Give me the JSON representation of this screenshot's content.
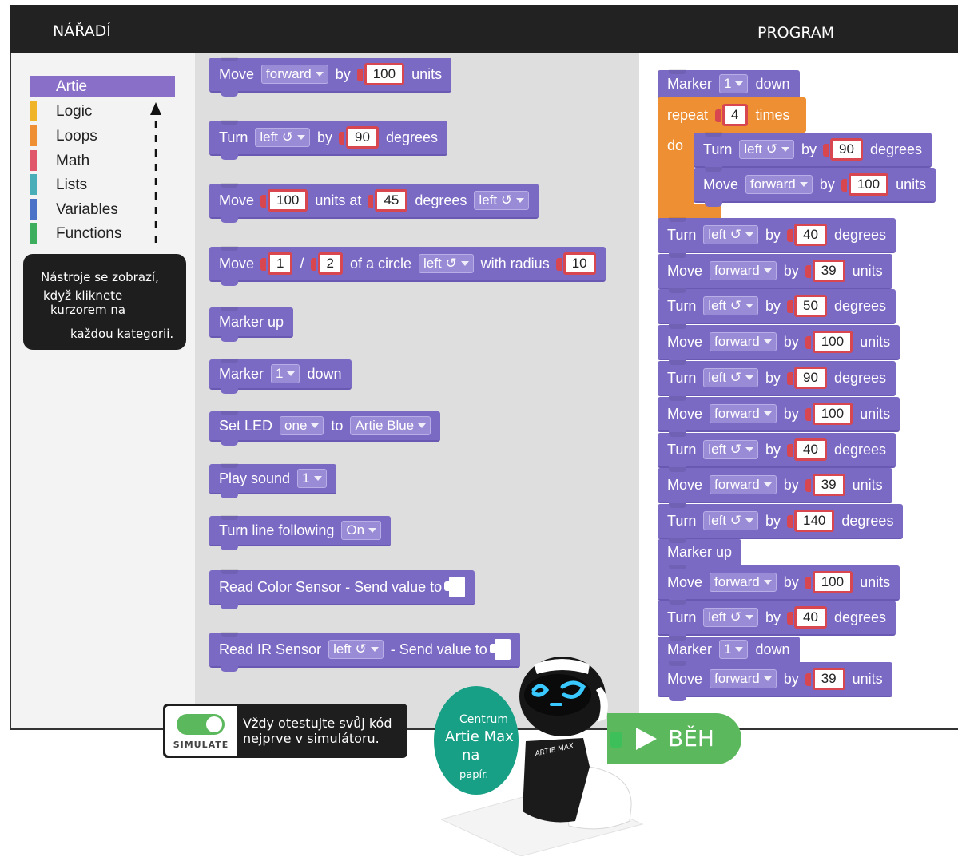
{
  "header": {
    "tools_title": "NÁŘADÍ",
    "program_title": "PROGRAM"
  },
  "categories": [
    {
      "label": "Artie",
      "color": "#8a6fc9",
      "selected": true
    },
    {
      "label": "Logic",
      "color": "#f0b429"
    },
    {
      "label": "Loops",
      "color": "#ed8f32"
    },
    {
      "label": "Math",
      "color": "#e0566b"
    },
    {
      "label": "Lists",
      "color": "#4aaeb8"
    },
    {
      "label": "Variables",
      "color": "#4a73c8"
    },
    {
      "label": "Functions",
      "color": "#3dae5e"
    }
  ],
  "tooltip": {
    "line1": "Nástroje se zobrazí,",
    "line2": "když kliknete",
    "line3": "kurzorem na",
    "line4": "každou kategorii."
  },
  "palette": {
    "move": {
      "w1": "Move",
      "dd": "forward",
      "w2": "by",
      "num": "100",
      "w3": "units"
    },
    "turn": {
      "w1": "Turn",
      "dd": "left ↺",
      "w2": "by",
      "num": "90",
      "w3": "degrees"
    },
    "move_arc": {
      "w1": "Move",
      "num1": "100",
      "w2": "units at",
      "num2": "45",
      "w3": "degrees",
      "dd": "left ↺"
    },
    "move_circle": {
      "w1": "Move",
      "num1": "1",
      "slash": "/",
      "num2": "2",
      "w2": "of a circle",
      "dd": "left ↺",
      "w3": "with radius",
      "num3": "10"
    },
    "marker_up": "Marker up",
    "marker_down": {
      "w1": "Marker",
      "dd": "1",
      "w2": "down"
    },
    "set_led": {
      "w1": "Set LED",
      "dd1": "one",
      "w2": "to",
      "dd2": "Artie Blue"
    },
    "play_sound": {
      "w1": "Play sound",
      "dd": "1"
    },
    "line_following": {
      "w1": "Turn line following",
      "dd": "On"
    },
    "color_sensor": "Read Color Sensor - Send value to",
    "ir_sensor": {
      "w1": "Read IR Sensor",
      "dd": "left ↺",
      "w2": "- Send value to"
    }
  },
  "program": {
    "marker_down_1": {
      "w1": "Marker",
      "dd": "1",
      "w2": "down"
    },
    "repeat": {
      "w1": "repeat",
      "num": "4",
      "w2": "times",
      "do": "do"
    },
    "inner_turn": {
      "w1": "Turn",
      "dd": "left ↺",
      "w2": "by",
      "num": "90",
      "w3": "degrees"
    },
    "inner_move": {
      "w1": "Move",
      "dd": "forward",
      "w2": "by",
      "num": "100",
      "w3": "units"
    },
    "steps": [
      {
        "w1": "Turn",
        "dd": "left ↺",
        "w2": "by",
        "num": "40",
        "w3": "degrees"
      },
      {
        "w1": "Move",
        "dd": "forward",
        "w2": "by",
        "num": "39",
        "w3": "units"
      },
      {
        "w1": "Turn",
        "dd": "left ↺",
        "w2": "by",
        "num": "50",
        "w3": "degrees"
      },
      {
        "w1": "Move",
        "dd": "forward",
        "w2": "by",
        "num": "100",
        "w3": "units"
      },
      {
        "w1": "Turn",
        "dd": "left ↺",
        "w2": "by",
        "num": "90",
        "w3": "degrees"
      },
      {
        "w1": "Move",
        "dd": "forward",
        "w2": "by",
        "num": "100",
        "w3": "units"
      },
      {
        "w1": "Turn",
        "dd": "left ↺",
        "w2": "by",
        "num": "40",
        "w3": "degrees"
      },
      {
        "w1": "Move",
        "dd": "forward",
        "w2": "by",
        "num": "39",
        "w3": "units"
      },
      {
        "w1": "Turn",
        "dd": "left ↺",
        "w2": "by",
        "num": "140",
        "w3": "degrees"
      }
    ],
    "marker_up": "Marker up",
    "steps2": [
      {
        "w1": "Move",
        "dd": "forward",
        "w2": "by",
        "num": "100",
        "w3": "units"
      },
      {
        "w1": "Turn",
        "dd": "left ↺",
        "w2": "by",
        "num": "40",
        "w3": "degrees"
      }
    ],
    "marker_down_2": {
      "w1": "Marker",
      "dd": "1",
      "w2": "down"
    },
    "last_move": {
      "w1": "Move",
      "dd": "forward",
      "w2": "by",
      "num": "39",
      "w3": "units"
    }
  },
  "simulate": {
    "label": "SIMULATE",
    "text1": "Vždy otestujte svůj kód",
    "text2": "nejprve v simulátoru."
  },
  "run": {
    "label": "BĚH"
  },
  "circle": {
    "l1": "Centrum",
    "l2": "Artie Max",
    "l3": "na",
    "l4": "papír."
  },
  "robot": {
    "badge": "ARTIE MAX"
  }
}
